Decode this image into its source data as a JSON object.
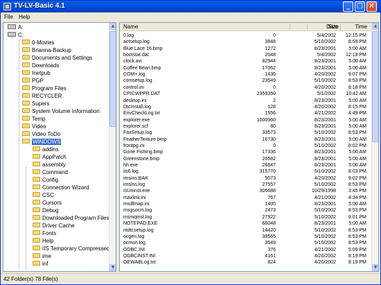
{
  "window": {
    "title": "TV-LV-Basic 4.1"
  },
  "menu": [
    "File",
    "Help"
  ],
  "tree": {
    "drives": [
      "A:",
      "C:"
    ],
    "folders": [
      "0-Movies",
      "Brianna-Backup",
      "Documents and Settings",
      "Downloads",
      "Inetpub",
      "PGP",
      "Program Files",
      "RECYCLER",
      "Supers",
      "System Volume Information",
      "Temp",
      "Video",
      "Video ToDo"
    ],
    "selected": "WINDOWS",
    "subfolders": [
      "addins",
      "AppPatch",
      "assembly",
      "Command",
      "Config",
      "Connection Wizard",
      "CSC",
      "Cursors",
      "Debug",
      "Downloaded Program Files",
      "Driver Cache",
      "Fonts",
      "Help",
      "IIS Temporary Compressed Fil",
      "ime",
      "inf"
    ]
  },
  "list": {
    "columns": {
      "name": "Name",
      "size": "Size",
      "date": "Date",
      "time": "Time"
    },
    "files": [
      [
        "0.log",
        "0",
        "5/4/2002",
        "12:15 PM"
      ],
      [
        "actsetup.log",
        "3848",
        "5/10/2002",
        "8:59 PM"
      ],
      [
        "Blue Lace 16.bmp",
        "1272",
        "8/23/2001",
        "5:00 AM"
      ],
      [
        "bootstat.dat",
        "2048",
        "5/4/2002",
        "12:19 PM"
      ],
      [
        "clock.avi",
        "82944",
        "8/23/2001",
        "5:00 AM"
      ],
      [
        "Coffee Bean.bmp",
        "17062",
        "8/23/2001",
        "5:00 AM"
      ],
      [
        "COM+.log",
        "1436",
        "4/20/2002",
        "9:07 PM"
      ],
      [
        "comsetup.log",
        "23549",
        "5/10/2002",
        "8:53 PM"
      ],
      [
        "control.ini",
        "0",
        "4/20/2002",
        "8:18 PM"
      ],
      [
        "CPICWPPR.DAT",
        "2359350",
        "5/1/2002",
        "10:42 AM"
      ],
      [
        "desktop.ini",
        "2",
        "8/23/2001",
        "5:00 AM"
      ],
      [
        "DtcInstall.log",
        "128",
        "4/20/2002",
        "8:15 PM"
      ],
      [
        "EnvCheckLog.txt",
        "1556",
        "4/21/2002",
        "4:49 PM"
      ],
      [
        "explorer.exe",
        "1000960",
        "8/23/2001",
        "5:00 AM"
      ],
      [
        "explorer.scf",
        "80",
        "8/23/2001",
        "5:00 AM"
      ],
      [
        "FaxSetup.log",
        "33573",
        "5/10/2002",
        "8:53 PM"
      ],
      [
        "FeatherTexture.bmp",
        "16730",
        "8/23/2001",
        "5:00 AM"
      ],
      [
        "frontpg.ini",
        "0",
        "5/10/2002",
        "8:02 PM"
      ],
      [
        "Gone Fishing.bmp",
        "17336",
        "8/23/2001",
        "5:00 AM"
      ],
      [
        "Greenstone.bmp",
        "26582",
        "8/23/2001",
        "5:00 AM"
      ],
      [
        "hh.exe",
        "26647",
        "8/23/2001",
        "5:00 AM"
      ],
      [
        "iis6.log",
        "315770",
        "5/10/2002",
        "8:03 PM"
      ],
      [
        "imsins.BAK",
        "5073",
        "4/20/2002",
        "9:02 PM"
      ],
      [
        "imsins.log",
        "27557",
        "5/10/2002",
        "8:53 PM"
      ],
      [
        "IsUninst.exe",
        "306688",
        "10/29/1998",
        "3:45 PM"
      ],
      [
        "maxlink.ini",
        "767",
        "4/21/2002",
        "4:34 PM"
      ],
      [
        "msdfmap.ini",
        "1405",
        "8/23/2001",
        "5:00 AM"
      ],
      [
        "msgsocm.log",
        "2473",
        "5/10/2002",
        "8:53 PM"
      ],
      [
        "msmqinst.log",
        "27922",
        "5/10/2002",
        "8:01 PM"
      ],
      [
        "NOTEPAD.EXE",
        "66048",
        "8/23/2001",
        "5:00 AM"
      ],
      [
        "ntdtcsetup.log",
        "14420",
        "5/10/2002",
        "8:53 PM"
      ],
      [
        "ocgen.log",
        "38565",
        "5/10/2002",
        "8:53 PM"
      ],
      [
        "ocmsn.log",
        "3549",
        "5/10/2002",
        "8:53 PM"
      ],
      [
        "ODBC.INI",
        "376",
        "4/21/2002",
        "5:09 PM"
      ],
      [
        "ODBCINST.INI",
        "4161",
        "4/20/2002",
        "8:19 PM"
      ],
      [
        "OEWABLog.txt",
        "824",
        "4/20/2002",
        "8:19 PM"
      ]
    ]
  },
  "status": {
    "text": "42 Folder(s)  78 File(s)"
  },
  "colors": {
    "title_bar": "#0553e1",
    "selection": "#316ac5",
    "folder": "#f5d77a"
  },
  "icons": {
    "app": "app-icon",
    "folder": "folder-icon",
    "drive": "drive-icon"
  }
}
